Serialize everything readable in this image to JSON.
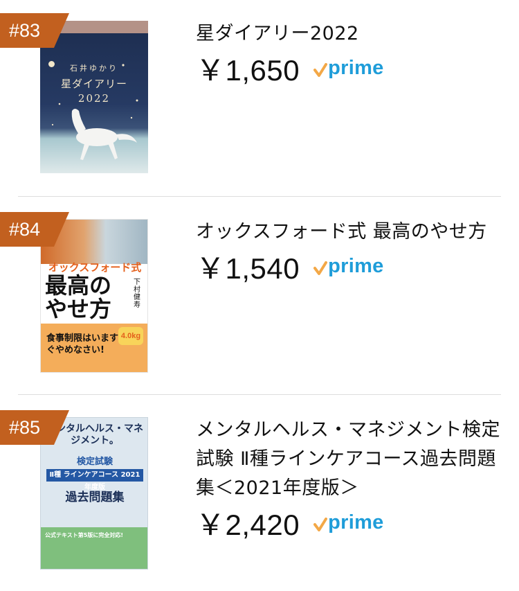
{
  "items": [
    {
      "rank": "#83",
      "title": "星ダイアリー2022",
      "price": "￥1,650",
      "prime_label": "prime",
      "cover": {
        "author": "石井ゆかり",
        "title": "星ダイアリー",
        "year": "2022"
      }
    },
    {
      "rank": "#84",
      "title": "オックスフォード式 最高のやせ方",
      "price": "￥1,540",
      "prime_label": "prime",
      "cover": {
        "top": "オックスフォード式",
        "big": "最高のやせ方",
        "author": "下村健寿",
        "band": "食事制限はいますぐやめなさい!",
        "kg": "4.0kg"
      }
    },
    {
      "rank": "#85",
      "title": "メンタルヘルス・マネジメント検定試験 Ⅱ種ラインケアコース過去問題集＜2021年度版＞",
      "price": "￥2,420",
      "prime_label": "prime",
      "cover": {
        "head": "メンタルヘルス・マネジメント。",
        "exam": "検定試験",
        "course": "Ⅱ種 ラインケアコース 2021年度版",
        "past": "過去問題集",
        "band": "公式テキスト第5版に完全対応!"
      }
    }
  ],
  "colors": {
    "rank_badge": "#c2601f",
    "prime_blue": "#1f9dd9",
    "prime_check": "#f3a847",
    "divider": "#dddddd"
  },
  "icons": {
    "prime": "prime-check-icon"
  }
}
